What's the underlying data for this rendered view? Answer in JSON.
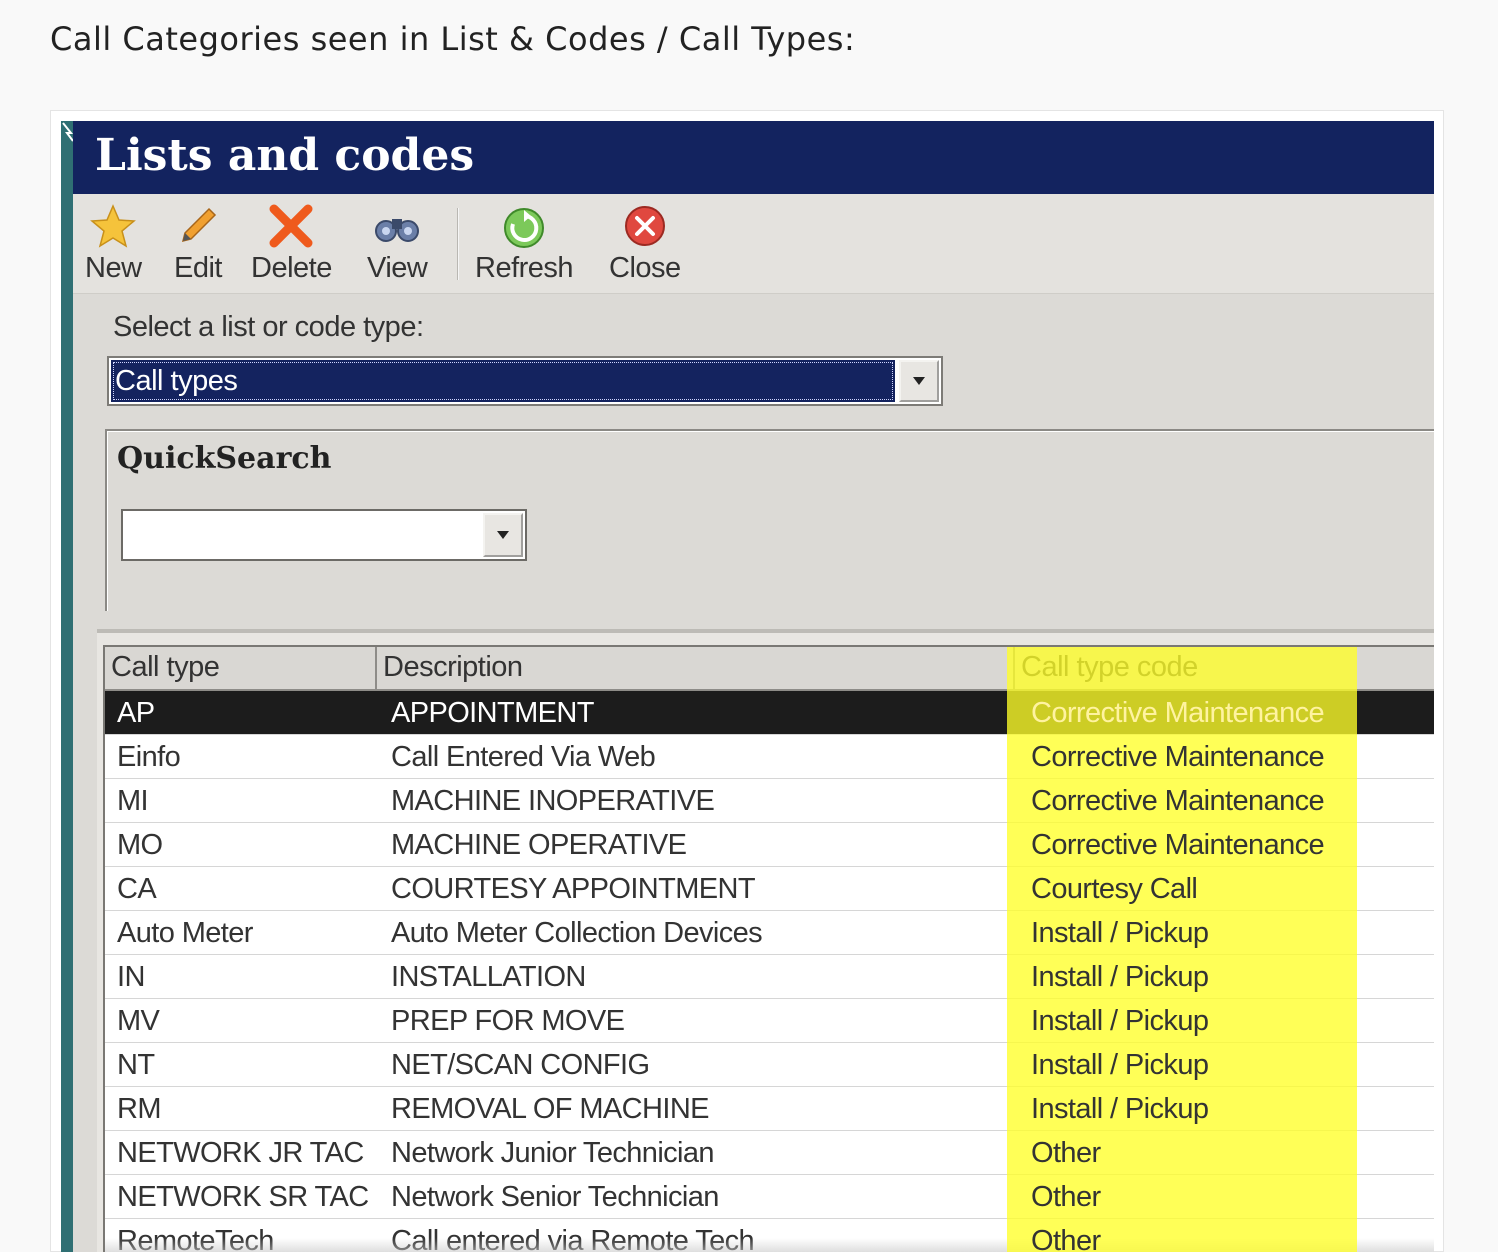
{
  "caption": "Call Categories seen in List & Codes / Call Types:",
  "window": {
    "title": "Lists and codes"
  },
  "toolbar": {
    "new": "New",
    "edit": "Edit",
    "delete": "Delete",
    "view": "View",
    "refresh": "Refresh",
    "close": "Close",
    "icons": [
      "star-icon",
      "pencil-icon",
      "x-delete-icon",
      "binoculars-icon",
      "refresh-icon",
      "close-circle-icon"
    ]
  },
  "select": {
    "label": "Select a list or code type:",
    "value": "Call types"
  },
  "quicksearch": {
    "title": "QuickSearch",
    "value": ""
  },
  "grid": {
    "headers": [
      "Call type",
      "Description",
      "Call type code"
    ],
    "highlight_color": "#ffff33",
    "rows": [
      [
        "AP",
        "APPOINTMENT",
        "Corrective Maintenance"
      ],
      [
        "Einfo",
        "Call Entered Via Web",
        "Corrective Maintenance"
      ],
      [
        "MI",
        "MACHINE INOPERATIVE",
        "Corrective Maintenance"
      ],
      [
        "MO",
        "MACHINE OPERATIVE",
        "Corrective Maintenance"
      ],
      [
        "CA",
        "COURTESY APPOINTMENT",
        "Courtesy Call"
      ],
      [
        "Auto Meter",
        "Auto Meter Collection Devices",
        "Install / Pickup"
      ],
      [
        "IN",
        "INSTALLATION",
        "Install / Pickup"
      ],
      [
        "MV",
        "PREP FOR MOVE",
        "Install / Pickup"
      ],
      [
        "NT",
        "NET/SCAN CONFIG",
        "Install / Pickup"
      ],
      [
        "RM",
        "REMOVAL OF MACHINE",
        "Install / Pickup"
      ],
      [
        "NETWORK JR TAC",
        "Network Junior Technician",
        "Other"
      ],
      [
        "NETWORK SR TAC",
        "Network Senior Technician",
        "Other"
      ],
      [
        "RemoteTech",
        "Call entered via Remote Tech",
        "Other"
      ]
    ]
  },
  "colors": {
    "titlebar": "#13235f",
    "selected_row": "#1c1c1c",
    "window_bg": "#dcdad6"
  }
}
